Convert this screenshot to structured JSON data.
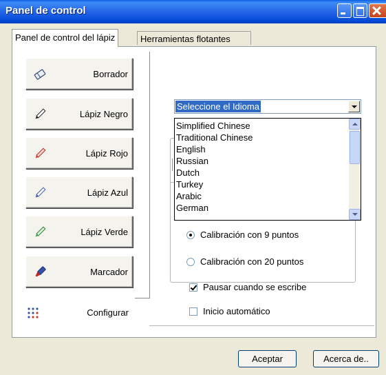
{
  "window": {
    "title": "Panel de control"
  },
  "tabs": [
    {
      "label": "Panel de control del lápiz",
      "active": true
    },
    {
      "label": "Herramientas flotantes",
      "active": false
    }
  ],
  "tools": [
    {
      "label": "Borrador",
      "icon": "eraser-icon"
    },
    {
      "label": "Lápiz Negro",
      "icon": "black-pencil-icon"
    },
    {
      "label": "Lápiz Rojo",
      "icon": "red-pencil-icon"
    },
    {
      "label": "Lápiz Azul",
      "icon": "blue-pencil-icon"
    },
    {
      "label": "Lápiz Verde",
      "icon": "green-pencil-icon"
    },
    {
      "label": "Marcador",
      "icon": "marker-icon"
    },
    {
      "label": "Configurar",
      "icon": "settings-dots-icon"
    }
  ],
  "language": {
    "selected": "Seleccione el Idioma",
    "options": [
      "Simplified Chinese",
      "Traditional Chinese",
      "English",
      "Russian",
      "Dutch",
      "Turkey",
      "Arabic",
      "German"
    ]
  },
  "calibration": {
    "options": [
      {
        "label": "Calibración con 9 puntos",
        "selected": true
      },
      {
        "label": "Calibración con 20 puntos",
        "selected": false
      }
    ]
  },
  "settings": {
    "pause_when_writing": {
      "label": "Pausar cuando se escribe",
      "checked": true
    },
    "auto_start": {
      "label": "Inicio automático",
      "checked": false
    }
  },
  "footer": {
    "ok_label": "Aceptar",
    "about_label": "Acerca de.."
  },
  "colors": {
    "titlebar": "#2465e8",
    "selection": "#316ac5",
    "red_pencil": "#d23a2e",
    "blue_pencil": "#3a57a8",
    "green_pencil": "#3fa14a"
  }
}
